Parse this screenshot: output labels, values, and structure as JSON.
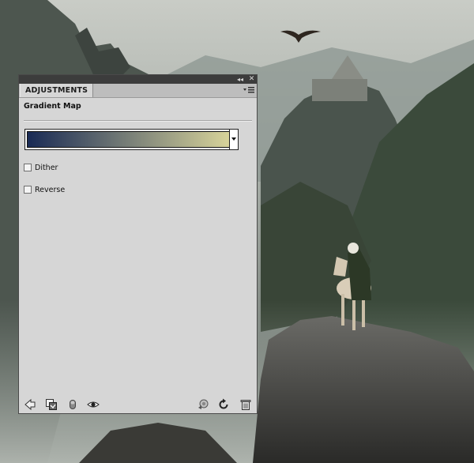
{
  "panel": {
    "tab_label": "ADJUSTMENTS",
    "collapse_glyph": "◂◂",
    "close_glyph": "✕",
    "menu_icon": "panel-menu-icon",
    "adjustment_title": "Gradient Map"
  },
  "gradient": {
    "start_color": "#192a55",
    "end_color": "#d8d49a"
  },
  "options": {
    "dither_label": "Dither",
    "dither_checked": false,
    "reverse_label": "Reverse",
    "reverse_checked": false
  },
  "bottom_bar": {
    "icons": [
      "back-arrow-icon",
      "clip-to-layer-icon",
      "mask-icon",
      "eye-icon",
      "previous-state-icon",
      "reset-icon",
      "trash-icon"
    ]
  }
}
